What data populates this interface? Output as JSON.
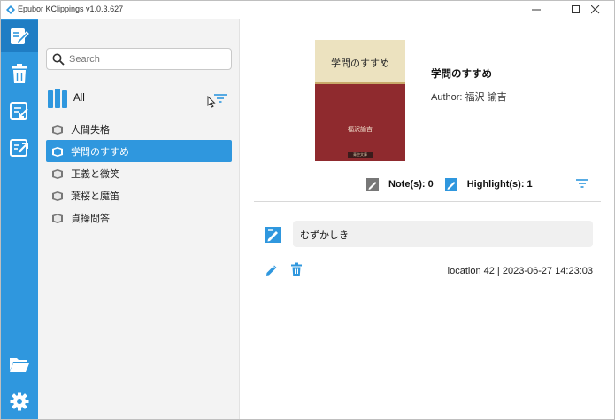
{
  "window": {
    "title": "Epubor KClippings v1.0.3.627"
  },
  "search": {
    "placeholder": "Search",
    "value": ""
  },
  "library": {
    "all_label": "All"
  },
  "books": [
    {
      "title": "人間失格",
      "selected": false
    },
    {
      "title": "学問のすすめ",
      "selected": true
    },
    {
      "title": "正義と微笑",
      "selected": false
    },
    {
      "title": "葉桜と魔笛",
      "selected": false
    },
    {
      "title": "貞操問答",
      "selected": false
    }
  ],
  "detail": {
    "cover_title": "学問のすすめ",
    "cover_author": "福沢諭吉",
    "cover_publisher": "青空文庫",
    "title": "学問のすすめ",
    "author": "Author: 福沢 諭吉",
    "notes_label": "Note(s): 0",
    "highlights_label": "Highlight(s): 1"
  },
  "clippings": [
    {
      "text": "むずかしき",
      "meta": "location 42 | 2023-06-27 14:23:03"
    }
  ],
  "colors": {
    "accent": "#2f97de",
    "rail_active": "#1f7dc4",
    "panel_bg": "#f3f3f3",
    "cover_red": "#8f2a2e"
  },
  "icons": {
    "rail": [
      "notes-icon",
      "trash-icon",
      "import-icon",
      "export-icon",
      "folder-open-icon",
      "gear-icon"
    ],
    "filter": "filter-icon",
    "book": "book-icon"
  }
}
